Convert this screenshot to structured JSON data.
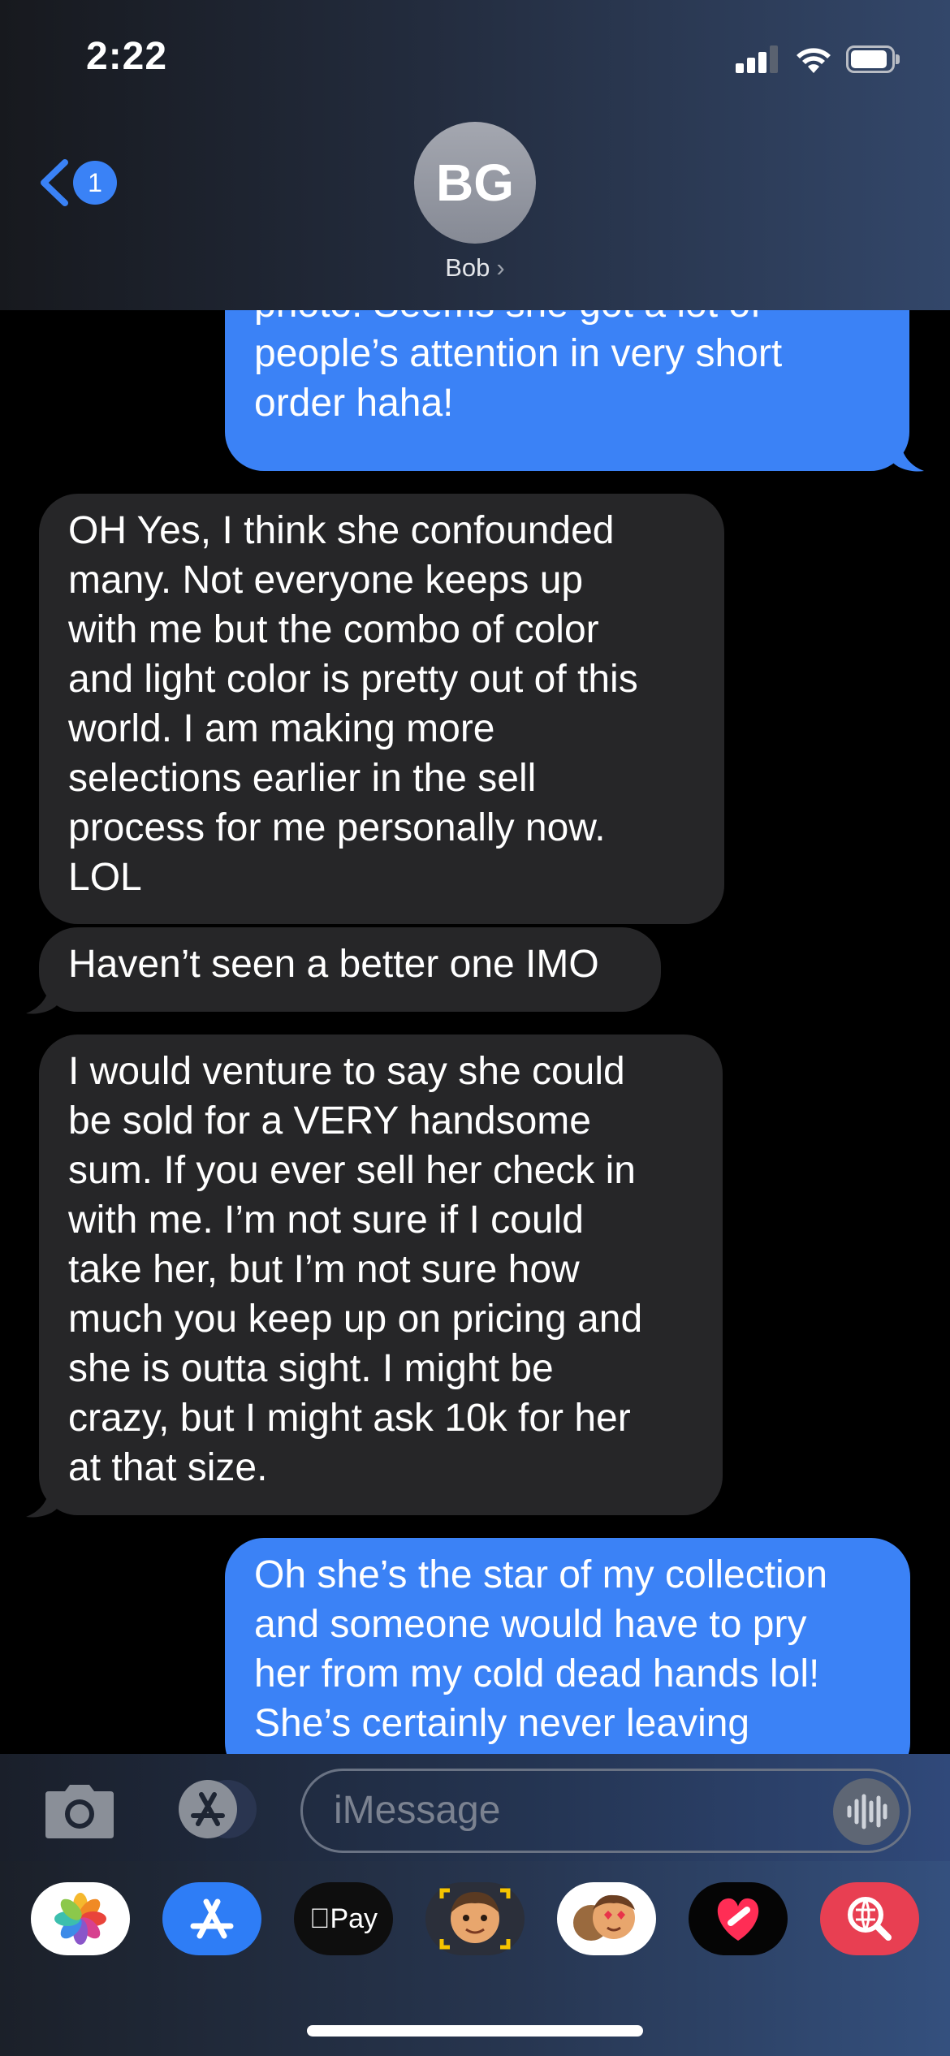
{
  "status_bar": {
    "time": "2:22"
  },
  "header": {
    "back_badge": "1",
    "avatar_initials": "BG",
    "contact_name": "Bob",
    "contact_chevron": "›"
  },
  "messages": [
    {
      "side": "sent",
      "lines": [
        "photo! Seems she got a lot of",
        "people’s attention in very short",
        "order haha!"
      ]
    },
    {
      "side": "received",
      "lines": [
        "OH Yes, I think she confounded",
        "many. Not everyone keeps up",
        "with me but the combo of color",
        "and light color is pretty out of this",
        "world. I am making more",
        "selections earlier in the sell",
        "process for me personally now.",
        "LOL"
      ]
    },
    {
      "side": "received",
      "lines": [
        "Haven’t seen a better one IMO"
      ]
    },
    {
      "side": "received",
      "lines": [
        "I would venture to say she could",
        "be sold for a VERY handsome",
        "sum. If you ever sell her check in",
        "with me. I’m not sure if I could",
        "take her, but I’m not sure how",
        "much you keep up on pricing and",
        "she is outta sight. I might be",
        "crazy, but I might ask 10k for her",
        "at that size."
      ]
    },
    {
      "side": "sent",
      "lines": [
        "Oh she’s the star of my collection",
        "and someone would have to pry",
        "her from my cold dead hands lol!",
        "She’s certainly never leaving"
      ]
    }
  ],
  "compose": {
    "placeholder": "iMessage"
  },
  "app_drawer": {
    "apple_pay_label": "Pay",
    "apps": [
      "photos-icon",
      "app-store-icon",
      "apple-pay-icon",
      "memoji-icon",
      "memoji-stickers-icon",
      "fitness-heart-icon",
      "image-search-icon"
    ]
  },
  "colors": {
    "sent_bubble": "#3b82f6",
    "received_bubble": "#262628",
    "badge": "#3a82f6"
  }
}
